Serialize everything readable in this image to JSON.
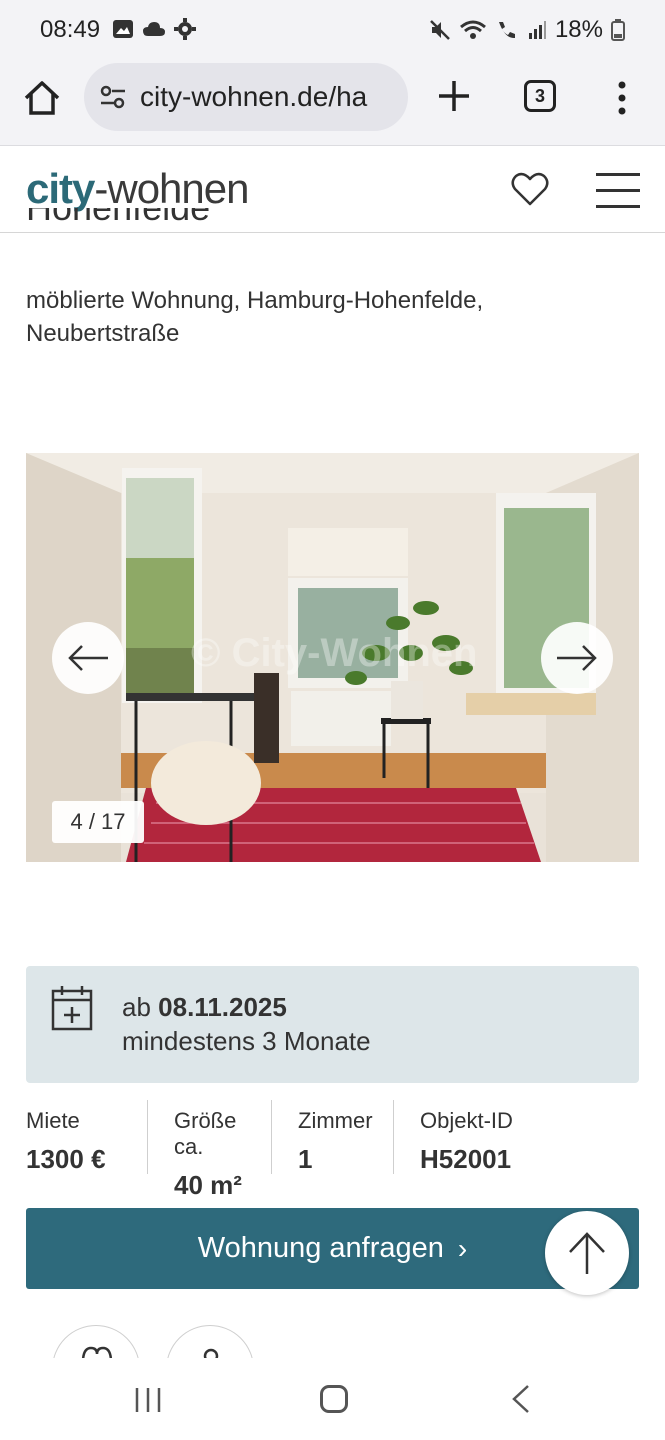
{
  "status_bar": {
    "time": "08:49",
    "battery": "18%"
  },
  "browser": {
    "url": "city-wohnen.de/ha",
    "tab_count": "3"
  },
  "site": {
    "logo_part1": "city",
    "logo_part2": "-wohnen"
  },
  "listing": {
    "title_cropped": "Hohenfelde",
    "subtitle": "möblierte Wohnung, Hamburg-Hohenfelde, Neubertstraße",
    "photo_counter": "4 / 17",
    "photo_watermark": "© City-Wohnen",
    "availability": {
      "prefix": "ab ",
      "date": "08.11.2025",
      "duration": "mindestens 3 Monate"
    },
    "facts": [
      {
        "label": "Miete",
        "value": "1300 €"
      },
      {
        "label": "Größe ca.",
        "value": "40 m²"
      },
      {
        "label": "Zimmer",
        "value": "1"
      },
      {
        "label": "Objekt-ID",
        "value": "H52001"
      }
    ],
    "cta_label": "Wohnung anfragen",
    "cta_chevron": "›"
  },
  "colors": {
    "brand": "#2e6a7c",
    "info_box": "#dde6e9"
  }
}
